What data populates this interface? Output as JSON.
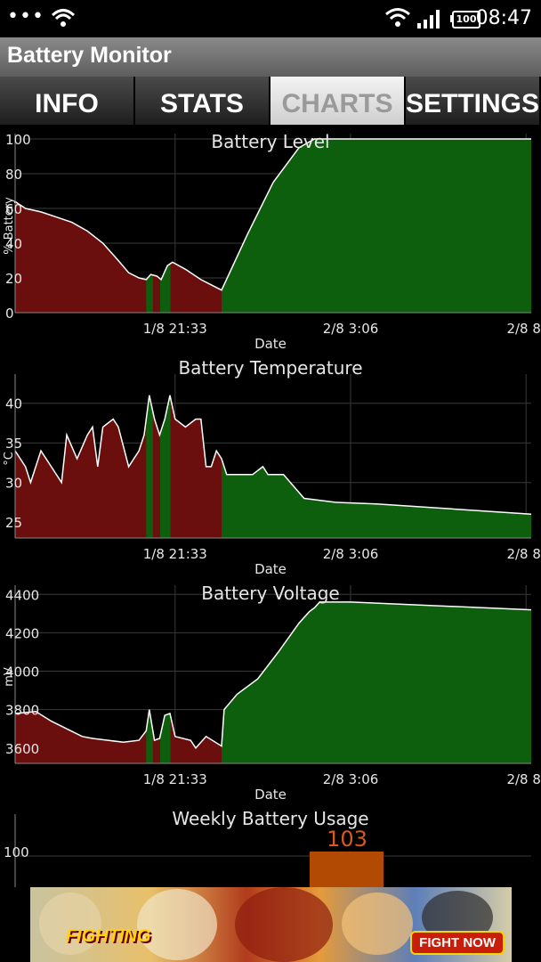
{
  "status_bar": {
    "dots": "•••",
    "battery_level": "100",
    "time": "08:47",
    "icons": [
      "wifi-icon",
      "signal-icon",
      "battery-icon"
    ]
  },
  "app": {
    "title": "Battery Monitor"
  },
  "tabs": [
    {
      "label": "INFO",
      "active": false
    },
    {
      "label": "STATS",
      "active": false
    },
    {
      "label": "CHARTS",
      "active": true
    },
    {
      "label": "SETTINGS",
      "active": false
    }
  ],
  "colors": {
    "discharge_fill": "#6b0e0e",
    "charge_fill": "#0d5e0d",
    "line": "#ffffff",
    "grid": "#3a3a3a",
    "usage_bar": "#b24a04",
    "usage_label": "#d9591a"
  },
  "chart_data": [
    {
      "type": "area",
      "title": "Battery Level",
      "xlabel": "Date",
      "ylabel": "% Battery",
      "ylim": [
        0,
        100
      ],
      "yticks": [
        "0",
        "20",
        "40",
        "60",
        "80",
        "100"
      ],
      "xticks": [
        "1/8 21:33",
        "2/8 3:06",
        "2/8 8:"
      ],
      "x_domain": [
        0,
        100
      ],
      "x_tick_positions": [
        31,
        65,
        99
      ],
      "charging_segments": [
        [
          25.4,
          26.7
        ],
        [
          28.1,
          30.1
        ],
        [
          40,
          100
        ]
      ],
      "points": [
        [
          0,
          64
        ],
        [
          2,
          60
        ],
        [
          5,
          58
        ],
        [
          8,
          55
        ],
        [
          11,
          52
        ],
        [
          14,
          47
        ],
        [
          17,
          40
        ],
        [
          20,
          30
        ],
        [
          22,
          23
        ],
        [
          24,
          20
        ],
        [
          25.4,
          19
        ],
        [
          26.3,
          22
        ],
        [
          27.5,
          21
        ],
        [
          28.3,
          19
        ],
        [
          29.5,
          27
        ],
        [
          30.5,
          29
        ],
        [
          33,
          25
        ],
        [
          36,
          19
        ],
        [
          38,
          16
        ],
        [
          40,
          13
        ],
        [
          45,
          45
        ],
        [
          50,
          75
        ],
        [
          55,
          95
        ],
        [
          58,
          100
        ],
        [
          100,
          100
        ]
      ]
    },
    {
      "type": "area",
      "title": "Battery Temperature",
      "xlabel": "Date",
      "ylabel": "°C",
      "ylim": [
        23,
        43
      ],
      "yticks": [
        "25",
        "30",
        "35",
        "40"
      ],
      "xticks": [
        "1/8 21:33",
        "2/8 3:06",
        "2/8 8:"
      ],
      "x_domain": [
        0,
        100
      ],
      "x_tick_positions": [
        31,
        65,
        99
      ],
      "charging_segments": [
        [
          25.4,
          26.7
        ],
        [
          28.1,
          30.1
        ],
        [
          40,
          100
        ]
      ],
      "points": [
        [
          0,
          34
        ],
        [
          2,
          32
        ],
        [
          3,
          30
        ],
        [
          5,
          34
        ],
        [
          7,
          32
        ],
        [
          9,
          30
        ],
        [
          10,
          36
        ],
        [
          12,
          33
        ],
        [
          14,
          36
        ],
        [
          15,
          37
        ],
        [
          16,
          32
        ],
        [
          17,
          37
        ],
        [
          19,
          38
        ],
        [
          20,
          37
        ],
        [
          22,
          32
        ],
        [
          24,
          34
        ],
        [
          25,
          36
        ],
        [
          26,
          41
        ],
        [
          27,
          38
        ],
        [
          28,
          36
        ],
        [
          29,
          38
        ],
        [
          30,
          41
        ],
        [
          31,
          38
        ],
        [
          33,
          37
        ],
        [
          35,
          38
        ],
        [
          36,
          38
        ],
        [
          37,
          32
        ],
        [
          38,
          32
        ],
        [
          39,
          34
        ],
        [
          40,
          33
        ],
        [
          41,
          31
        ],
        [
          46,
          31
        ],
        [
          48,
          32
        ],
        [
          49,
          31
        ],
        [
          52,
          31
        ],
        [
          56,
          28
        ],
        [
          62,
          27.5
        ],
        [
          70,
          27.3
        ],
        [
          100,
          26
        ]
      ]
    },
    {
      "type": "area",
      "title": "Battery Voltage",
      "xlabel": "Date",
      "ylabel": "mV",
      "ylim": [
        3520,
        4420
      ],
      "yticks": [
        "3600",
        "3800",
        "4000",
        "4200",
        "4400"
      ],
      "xticks": [
        "1/8 21:33",
        "2/8 3:06",
        "2/8 8:"
      ],
      "x_domain": [
        0,
        100
      ],
      "x_tick_positions": [
        31,
        65,
        99
      ],
      "charging_segments": [
        [
          25.4,
          26.7
        ],
        [
          28.1,
          30.1
        ],
        [
          40,
          100
        ]
      ],
      "points": [
        [
          0,
          3780
        ],
        [
          4,
          3790
        ],
        [
          7,
          3740
        ],
        [
          10,
          3700
        ],
        [
          13,
          3660
        ],
        [
          15,
          3650
        ],
        [
          18,
          3640
        ],
        [
          21,
          3630
        ],
        [
          24,
          3640
        ],
        [
          25.4,
          3690
        ],
        [
          26,
          3800
        ],
        [
          27,
          3640
        ],
        [
          28,
          3650
        ],
        [
          29,
          3770
        ],
        [
          30,
          3780
        ],
        [
          31,
          3660
        ],
        [
          34,
          3640
        ],
        [
          35,
          3600
        ],
        [
          37,
          3660
        ],
        [
          40,
          3610
        ],
        [
          40.5,
          3800
        ],
        [
          43,
          3880
        ],
        [
          47,
          3960
        ],
        [
          51,
          4100
        ],
        [
          55,
          4250
        ],
        [
          57,
          4310
        ],
        [
          58,
          4330
        ],
        [
          59,
          4360
        ],
        [
          60,
          4360
        ],
        [
          65,
          4360
        ],
        [
          100,
          4320
        ]
      ]
    },
    {
      "type": "bar",
      "title": "Weekly Battery Usage",
      "yticks": [
        "100"
      ],
      "categories": [
        ""
      ],
      "values": [
        103
      ],
      "data_label": "103"
    }
  ],
  "ad": {
    "brand_text": "FIGHTING",
    "cta_label": "FIGHT NOW"
  }
}
